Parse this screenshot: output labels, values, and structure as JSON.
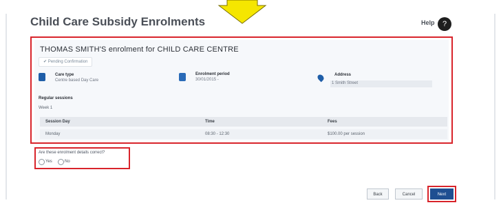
{
  "page": {
    "title": "Child Care Subsidy Enrolments",
    "help_label": "Help"
  },
  "enrolment": {
    "title": "THOMAS SMITH'S enrolment for CHILD CARE CENTRE",
    "status": "Pending Confirmation",
    "care_type_label": "Care type",
    "care_type_value": "Centre based Day Care",
    "period_label": "Enrolment period",
    "period_value": "30/01/2015 -",
    "address_label": "Address",
    "address_value": "1 Smith Street"
  },
  "sessions": {
    "heading": "Regular sessions",
    "week_label": "Week 1",
    "columns": [
      "Session Day",
      "Time",
      "Fees"
    ],
    "rows": [
      {
        "day": "Monday",
        "time": "08:30 - 12:30",
        "fees": "$100.00 per session"
      }
    ]
  },
  "question": {
    "text": "Are these enrolment details correct?",
    "options": [
      "Yes",
      "No"
    ]
  },
  "buttons": {
    "back": "Back",
    "cancel": "Cancel",
    "next": "Next"
  },
  "colors": {
    "highlight": "#d8232a",
    "primary": "#1f4f91",
    "arrow": "#f5e600"
  },
  "icons": {
    "care_type": "card-icon",
    "period": "calendar-icon",
    "address": "location-pin-icon",
    "status": "check-icon",
    "help": "help-icon",
    "arrow": "down-arrow-icon"
  }
}
